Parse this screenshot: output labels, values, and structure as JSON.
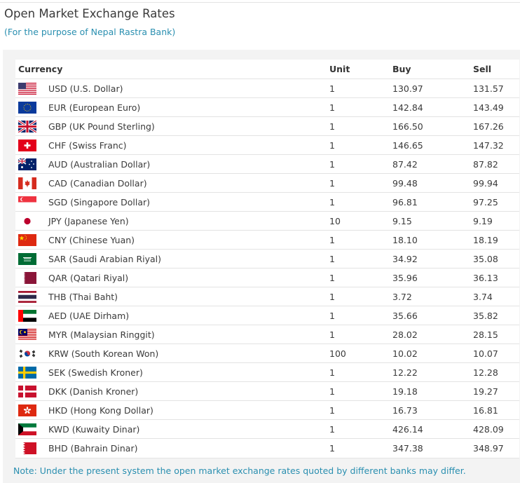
{
  "title": "Open Market Exchange Rates",
  "subtitle": "(For the purpose of Nepal Rastra Bank)",
  "table": {
    "headers": {
      "currency": "Currency",
      "unit": "Unit",
      "buy": "Buy",
      "sell": "Sell"
    },
    "rows": [
      {
        "flag": "us-flag-icon",
        "currency": "USD (U.S. Dollar)",
        "unit": "1",
        "buy": "130.97",
        "sell": "131.57"
      },
      {
        "flag": "eu-flag-icon",
        "currency": "EUR (European Euro)",
        "unit": "1",
        "buy": "142.84",
        "sell": "143.49"
      },
      {
        "flag": "uk-flag-icon",
        "currency": "GBP (UK Pound Sterling)",
        "unit": "1",
        "buy": "166.50",
        "sell": "167.26"
      },
      {
        "flag": "ch-flag-icon",
        "currency": "CHF (Swiss Franc)",
        "unit": "1",
        "buy": "146.65",
        "sell": "147.32"
      },
      {
        "flag": "au-flag-icon",
        "currency": "AUD (Australian Dollar)",
        "unit": "1",
        "buy": "87.42",
        "sell": "87.82"
      },
      {
        "flag": "ca-flag-icon",
        "currency": "CAD (Canadian Dollar)",
        "unit": "1",
        "buy": "99.48",
        "sell": "99.94"
      },
      {
        "flag": "sg-flag-icon",
        "currency": "SGD (Singapore Dollar)",
        "unit": "1",
        "buy": "96.81",
        "sell": "97.25"
      },
      {
        "flag": "jp-flag-icon",
        "currency": "JPY (Japanese Yen)",
        "unit": "10",
        "buy": "9.15",
        "sell": "9.19"
      },
      {
        "flag": "cn-flag-icon",
        "currency": "CNY (Chinese Yuan)",
        "unit": "1",
        "buy": "18.10",
        "sell": "18.19"
      },
      {
        "flag": "sa-flag-icon",
        "currency": "SAR (Saudi Arabian Riyal)",
        "unit": "1",
        "buy": "34.92",
        "sell": "35.08"
      },
      {
        "flag": "qa-flag-icon",
        "currency": "QAR (Qatari Riyal)",
        "unit": "1",
        "buy": "35.96",
        "sell": "36.13"
      },
      {
        "flag": "th-flag-icon",
        "currency": "THB (Thai Baht)",
        "unit": "1",
        "buy": "3.72",
        "sell": "3.74"
      },
      {
        "flag": "ae-flag-icon",
        "currency": "AED (UAE Dirham)",
        "unit": "1",
        "buy": "35.66",
        "sell": "35.82"
      },
      {
        "flag": "my-flag-icon",
        "currency": "MYR (Malaysian Ringgit)",
        "unit": "1",
        "buy": "28.02",
        "sell": "28.15"
      },
      {
        "flag": "kr-flag-icon",
        "currency": "KRW (South Korean Won)",
        "unit": "100",
        "buy": "10.02",
        "sell": "10.07"
      },
      {
        "flag": "se-flag-icon",
        "currency": "SEK (Swedish Kroner)",
        "unit": "1",
        "buy": "12.22",
        "sell": "12.28"
      },
      {
        "flag": "dk-flag-icon",
        "currency": "DKK (Danish Kroner)",
        "unit": "1",
        "buy": "19.18",
        "sell": "19.27"
      },
      {
        "flag": "hk-flag-icon",
        "currency": "HKD (Hong Kong Dollar)",
        "unit": "1",
        "buy": "16.73",
        "sell": "16.81"
      },
      {
        "flag": "kw-flag-icon",
        "currency": "KWD (Kuwaity Dinar)",
        "unit": "1",
        "buy": "426.14",
        "sell": "428.09"
      },
      {
        "flag": "bh-flag-icon",
        "currency": "BHD (Bahrain Dinar)",
        "unit": "1",
        "buy": "347.38",
        "sell": "348.97"
      }
    ]
  },
  "note": "Note: Under the present system the open market exchange rates quoted by different banks may differ.",
  "colors": {
    "accent": "#2a8fb0",
    "panel": "#f3f3f3",
    "divider": "#e3e3e3"
  }
}
